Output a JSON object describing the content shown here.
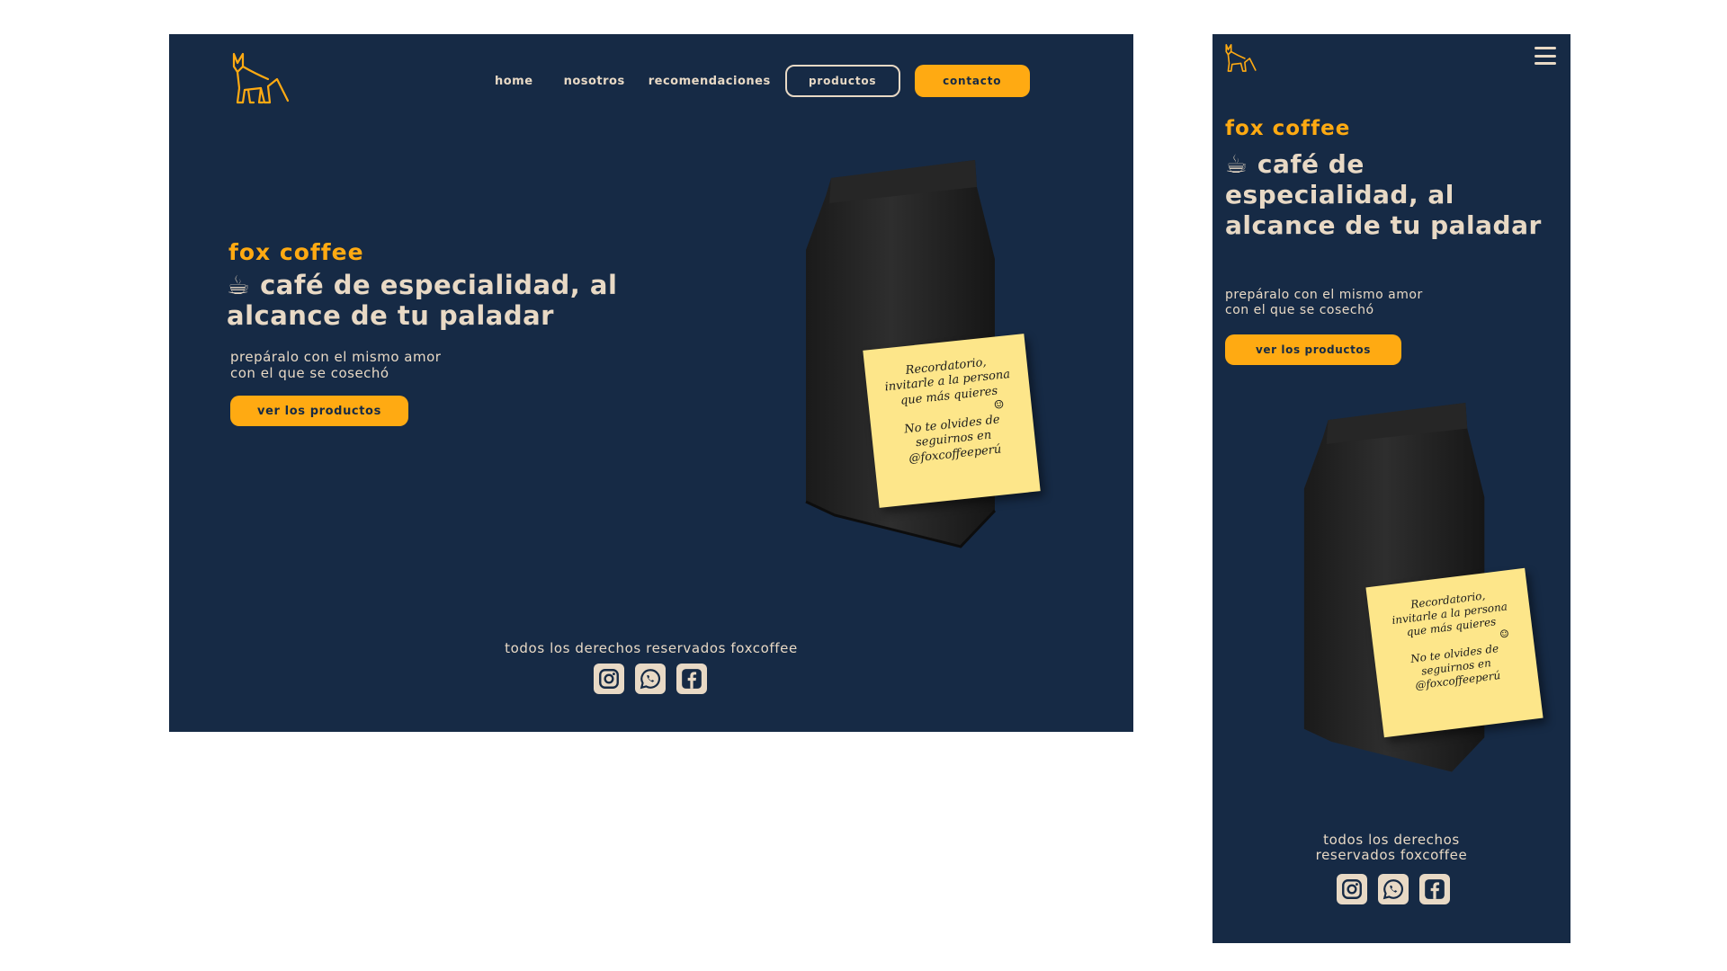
{
  "colors": {
    "background": "#162a45",
    "accent": "#ffaa12",
    "text": "#e8d9c5",
    "note": "#fde68a"
  },
  "nav": {
    "home": "home",
    "nosotros": "nosotros",
    "recomendaciones": "recomendaciones",
    "productos": "productos",
    "contacto": "contacto"
  },
  "hero": {
    "brand": "fox coffee",
    "headline_icon": "☕",
    "headline": "café de especialidad, al alcance de tu paladar",
    "subtitle_line1": "prepáralo con el mismo amor",
    "subtitle_line2": "con el que se cosechó",
    "cta": "ver los productos"
  },
  "note": {
    "line1": "Recordatorio,",
    "line2": "invitarle a la persona",
    "line3": "que más quieres",
    "smile": "☺",
    "line4": "No te olvides de",
    "line5": "seguirnos en",
    "line6": "@foxcoffeeperú"
  },
  "footer": {
    "text": "todos los derechos reservados foxcoffee",
    "mobile_line1": "todos los derechos",
    "mobile_line2": "reservados foxcoffee",
    "icons": [
      "instagram-icon",
      "whatsapp-icon",
      "facebook-icon"
    ]
  },
  "mobile": {
    "menu_icon": "hamburger-menu-icon"
  }
}
